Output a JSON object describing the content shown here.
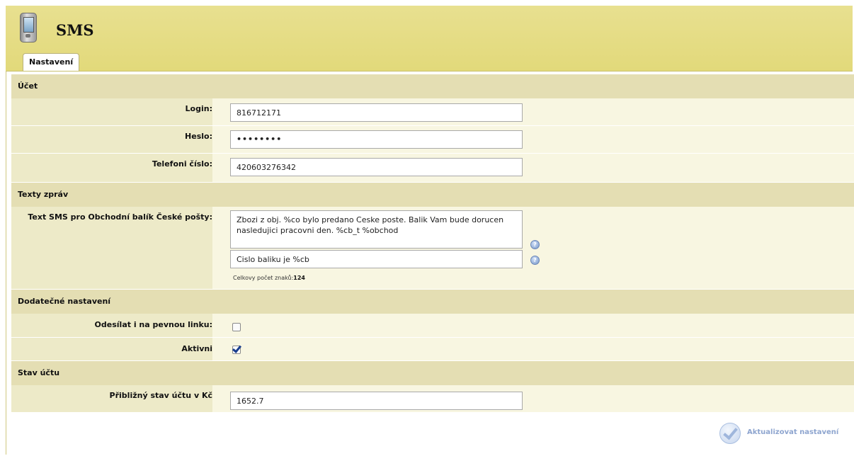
{
  "header": {
    "title": "SMS",
    "app_icon": "phone-icon"
  },
  "tabs": [
    {
      "label": "Nastavení"
    }
  ],
  "sections": {
    "account": {
      "title": "Účet",
      "login_label": "Login:",
      "login_value": "816712171",
      "password_label": "Heslo:",
      "password_value": "••••••••",
      "phone_label": "Telefoni číslo:",
      "phone_value": "420603276342"
    },
    "messages": {
      "title": "Texty zpráv",
      "sms_label": "Text SMS pro Obchodní balík České pošty:",
      "sms_text": "Zbozi z obj. %co bylo predano Ceske poste. Balik Vam bude dorucen nasledujici pracovni den. %cb_t %obchod",
      "sms_suffix": "Cislo baliku je %cb",
      "counter_label": "Celkovy počet znaků:",
      "counter_value": "124",
      "help_icon": "help-icon"
    },
    "additional": {
      "title": "Dodatečné nastavení",
      "landline_label": "Odesílat i na pevnou linku:",
      "landline_checked": false,
      "active_label": "Aktivni",
      "active_checked": true
    },
    "balance": {
      "title": "Stav účtu",
      "balance_label": "Přibližný stav účtu v Kč",
      "balance_value": "1652.7"
    }
  },
  "actions": {
    "update_label": "Aktualizovat nastavení"
  },
  "colors": {
    "header_bg": "#e2d97a",
    "section_bg": "#e4deb3",
    "label_bg": "#edeac8",
    "row_bg": "#f8f6e1",
    "button_text": "#8ea5cf"
  }
}
